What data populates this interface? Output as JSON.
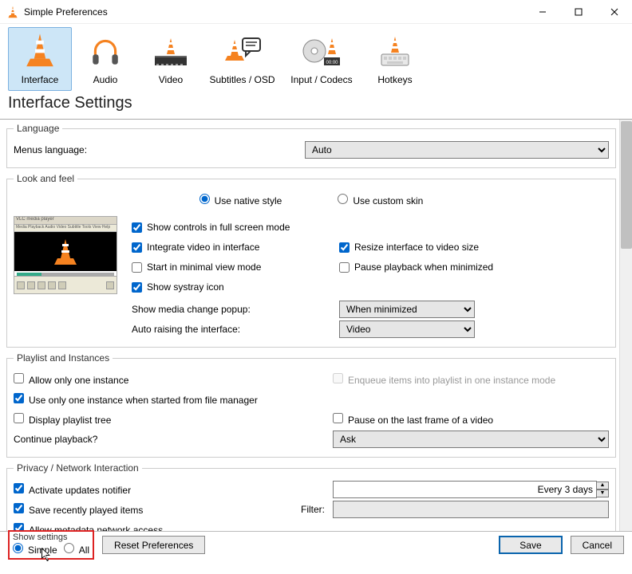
{
  "window": {
    "title": "Simple Preferences"
  },
  "tabs": {
    "interface": "Interface",
    "audio": "Audio",
    "video": "Video",
    "subtitles": "Subtitles / OSD",
    "codecs": "Input / Codecs",
    "hotkeys": "Hotkeys"
  },
  "heading": "Interface Settings",
  "lang": {
    "legend": "Language",
    "menus_label": "Menus language:",
    "value": "Auto"
  },
  "look": {
    "legend": "Look and feel",
    "native": "Use native style",
    "custom": "Use custom skin",
    "full_screen_controls": "Show controls in full screen mode",
    "integrate_video": "Integrate video in interface",
    "resize_to_video": "Resize interface to video size",
    "start_minimal": "Start in minimal view mode",
    "pause_minimized": "Pause playback when minimized",
    "systray": "Show systray icon",
    "media_change_label": "Show media change popup:",
    "media_change_value": "When minimized",
    "auto_raise_label": "Auto raising the interface:",
    "auto_raise_value": "Video"
  },
  "playlist": {
    "legend": "Playlist and Instances",
    "one_instance": "Allow only one instance",
    "enqueue": "Enqueue items into playlist in one instance mode",
    "one_instance_fm": "Use only one instance when started from file manager",
    "display_tree": "Display playlist tree",
    "pause_last_frame": "Pause on the last frame of a video",
    "continue_label": "Continue playback?",
    "continue_value": "Ask"
  },
  "privacy": {
    "legend": "Privacy / Network Interaction",
    "updates": "Activate updates notifier",
    "updates_freq": "Every 3 days",
    "save_recent": "Save recently played items",
    "filter_label": "Filter:",
    "metadata": "Allow metadata network access"
  },
  "footer": {
    "show_settings": "Show settings",
    "simple": "Simple",
    "all": "All",
    "reset": "Reset Preferences",
    "save": "Save",
    "cancel": "Cancel"
  }
}
